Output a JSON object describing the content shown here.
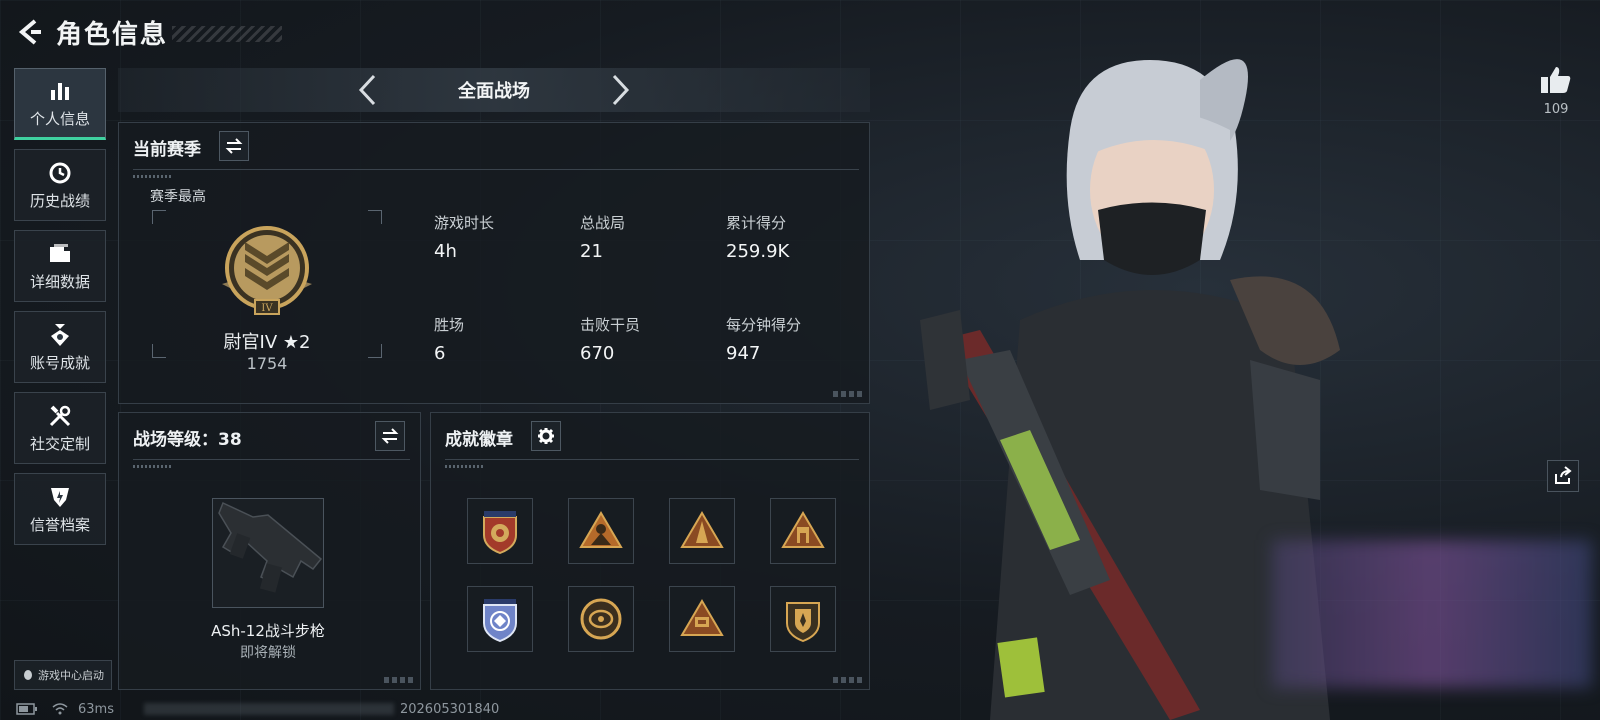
{
  "header": {
    "title": "角色信息"
  },
  "sidebar": {
    "items": [
      {
        "label": "个人信息",
        "icon": "bar-chart-icon",
        "active": true
      },
      {
        "label": "历史战绩",
        "icon": "history-icon",
        "active": false
      },
      {
        "label": "详细数据",
        "icon": "folder-icon",
        "active": false
      },
      {
        "label": "账号成就",
        "icon": "achievement-icon",
        "active": false
      },
      {
        "label": "社交定制",
        "icon": "tools-icon",
        "active": false
      },
      {
        "label": "信誉档案",
        "icon": "credit-icon",
        "active": false
      }
    ],
    "launch_label": "游戏中心启动"
  },
  "mode": {
    "title": "全面战场"
  },
  "season": {
    "title": "当前赛季",
    "best_label": "赛季最高",
    "rank_name": "尉官IV ★2",
    "rank_score": "1754",
    "stats": [
      {
        "label": "游戏时长",
        "value": "4h"
      },
      {
        "label": "总战局",
        "value": "21"
      },
      {
        "label": "累计得分",
        "value": "259.9K"
      },
      {
        "label": "胜场",
        "value": "6"
      },
      {
        "label": "击败干员",
        "value": "670"
      },
      {
        "label": "每分钟得分",
        "value": "947"
      }
    ]
  },
  "battlefield": {
    "title": "战场等级：38",
    "weapon_name": "ASh-12战斗步枪",
    "weapon_status": "即将解锁"
  },
  "badges": {
    "title": "成就徽章",
    "items": [
      "badge-shield-stars",
      "badge-triangle-figure",
      "badge-triangle-tower",
      "badge-triangle-arch",
      "badge-shield-blue",
      "badge-circle-gold",
      "badge-triangle-58",
      "badge-shield-emblem"
    ]
  },
  "right": {
    "like_count": "109"
  },
  "status": {
    "ping": "63ms",
    "timestamp": "202605301840"
  },
  "colors": {
    "accent": "#3fd1a0",
    "gold": "#c9a45c",
    "panel_border": "#353e47"
  }
}
